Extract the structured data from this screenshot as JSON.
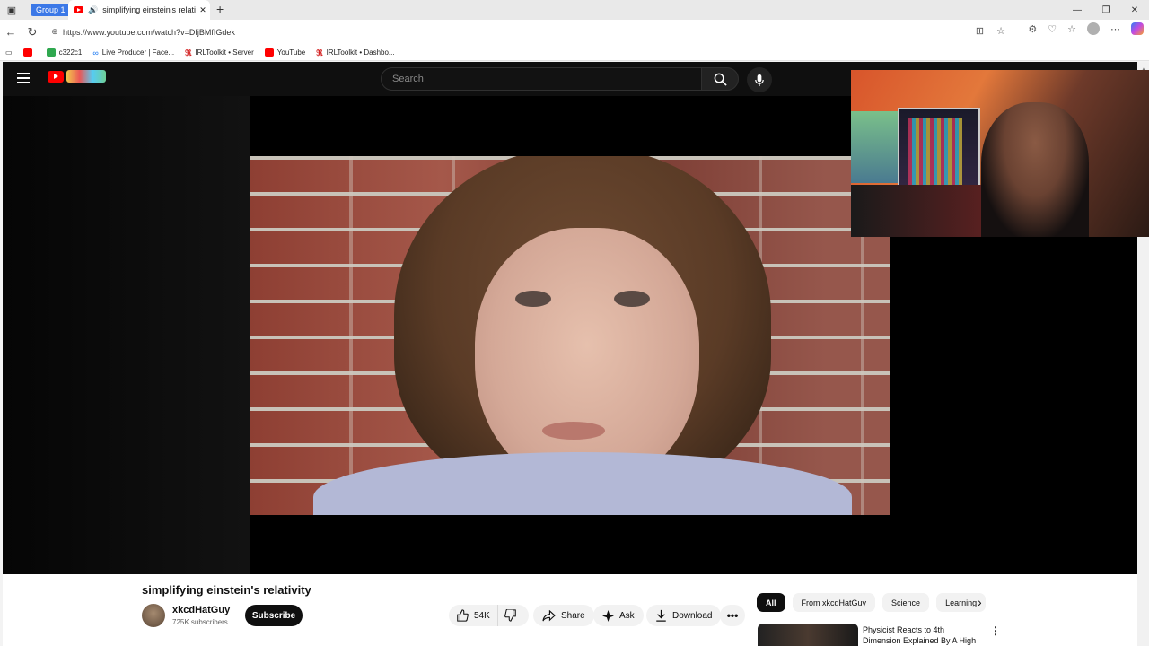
{
  "browser": {
    "tab_group_label": "Group 1",
    "active_tab_title": "simplifying einstein's relativity",
    "url": "https://www.youtube.com/watch?v=DIjBMfIGdek",
    "bookmarks": [
      {
        "label": "",
        "icon": "youtube-icon"
      },
      {
        "label": "c322c1",
        "icon": "kick-icon"
      },
      {
        "label": "Live Producer | Face...",
        "icon": "meta-icon"
      },
      {
        "label": "IRLToolkit • Server",
        "icon": "irltoolkit-icon"
      },
      {
        "label": "YouTube",
        "icon": "youtube-icon"
      },
      {
        "label": "IRLToolkit • Dashbo...",
        "icon": "irltoolkit-icon"
      }
    ]
  },
  "youtube": {
    "search_placeholder": "Search",
    "video": {
      "title": "simplifying einstein's relativity",
      "channel_name": "xkcdHatGuy",
      "subscribers": "725K subscribers",
      "subscribe_label": "Subscribe",
      "likes": "54K",
      "share_label": "Share",
      "ask_label": "Ask",
      "download_label": "Download"
    },
    "chips": [
      "All",
      "From xkcdHatGuy",
      "Science",
      "Learning"
    ],
    "recommendation": {
      "title": "Physicist Reacts to 4th Dimension Explained By A High"
    }
  },
  "colors": {
    "youtube_red": "#ff0000",
    "masthead_bg": "#0f0f0f",
    "tab_group": "#3b78e7"
  }
}
